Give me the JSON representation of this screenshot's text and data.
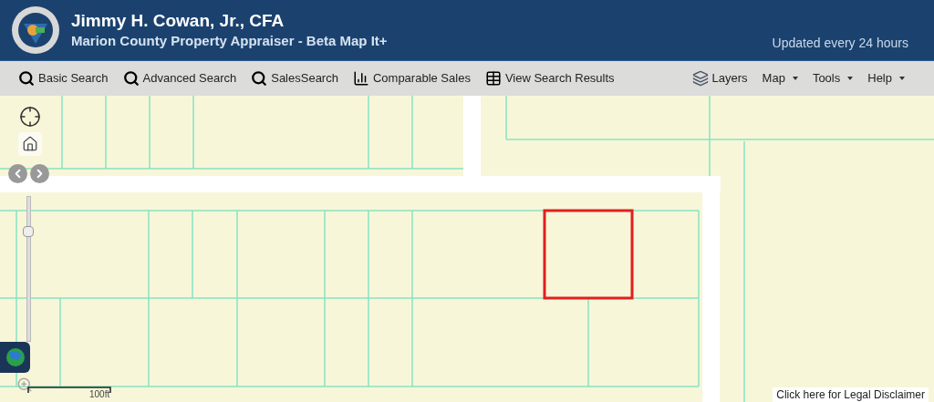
{
  "header": {
    "title": "Jimmy H. Cowan, Jr., CFA",
    "subtitle": "Marion County Property Appraiser - Beta Map It+",
    "update_note": "Updated every 24 hours"
  },
  "toolbar": {
    "left": [
      {
        "label": "Basic Search",
        "kind": "search"
      },
      {
        "label": "Advanced Search",
        "kind": "search"
      },
      {
        "label": "SalesSearch",
        "kind": "search"
      },
      {
        "label": "Comparable Sales",
        "kind": "chart"
      },
      {
        "label": "View Search Results",
        "kind": "table"
      }
    ],
    "right": [
      {
        "label": "Layers",
        "kind": "layers"
      },
      {
        "label": "Map",
        "kind": "menu"
      },
      {
        "label": "Tools",
        "kind": "menu"
      },
      {
        "label": "Help",
        "kind": "menu"
      }
    ]
  },
  "map": {
    "kind": "picture",
    "zoom": {
      "level": 0.78
    },
    "scale_label": "100ft",
    "disclaimer": "Click here for Legal Disclaimer"
  }
}
